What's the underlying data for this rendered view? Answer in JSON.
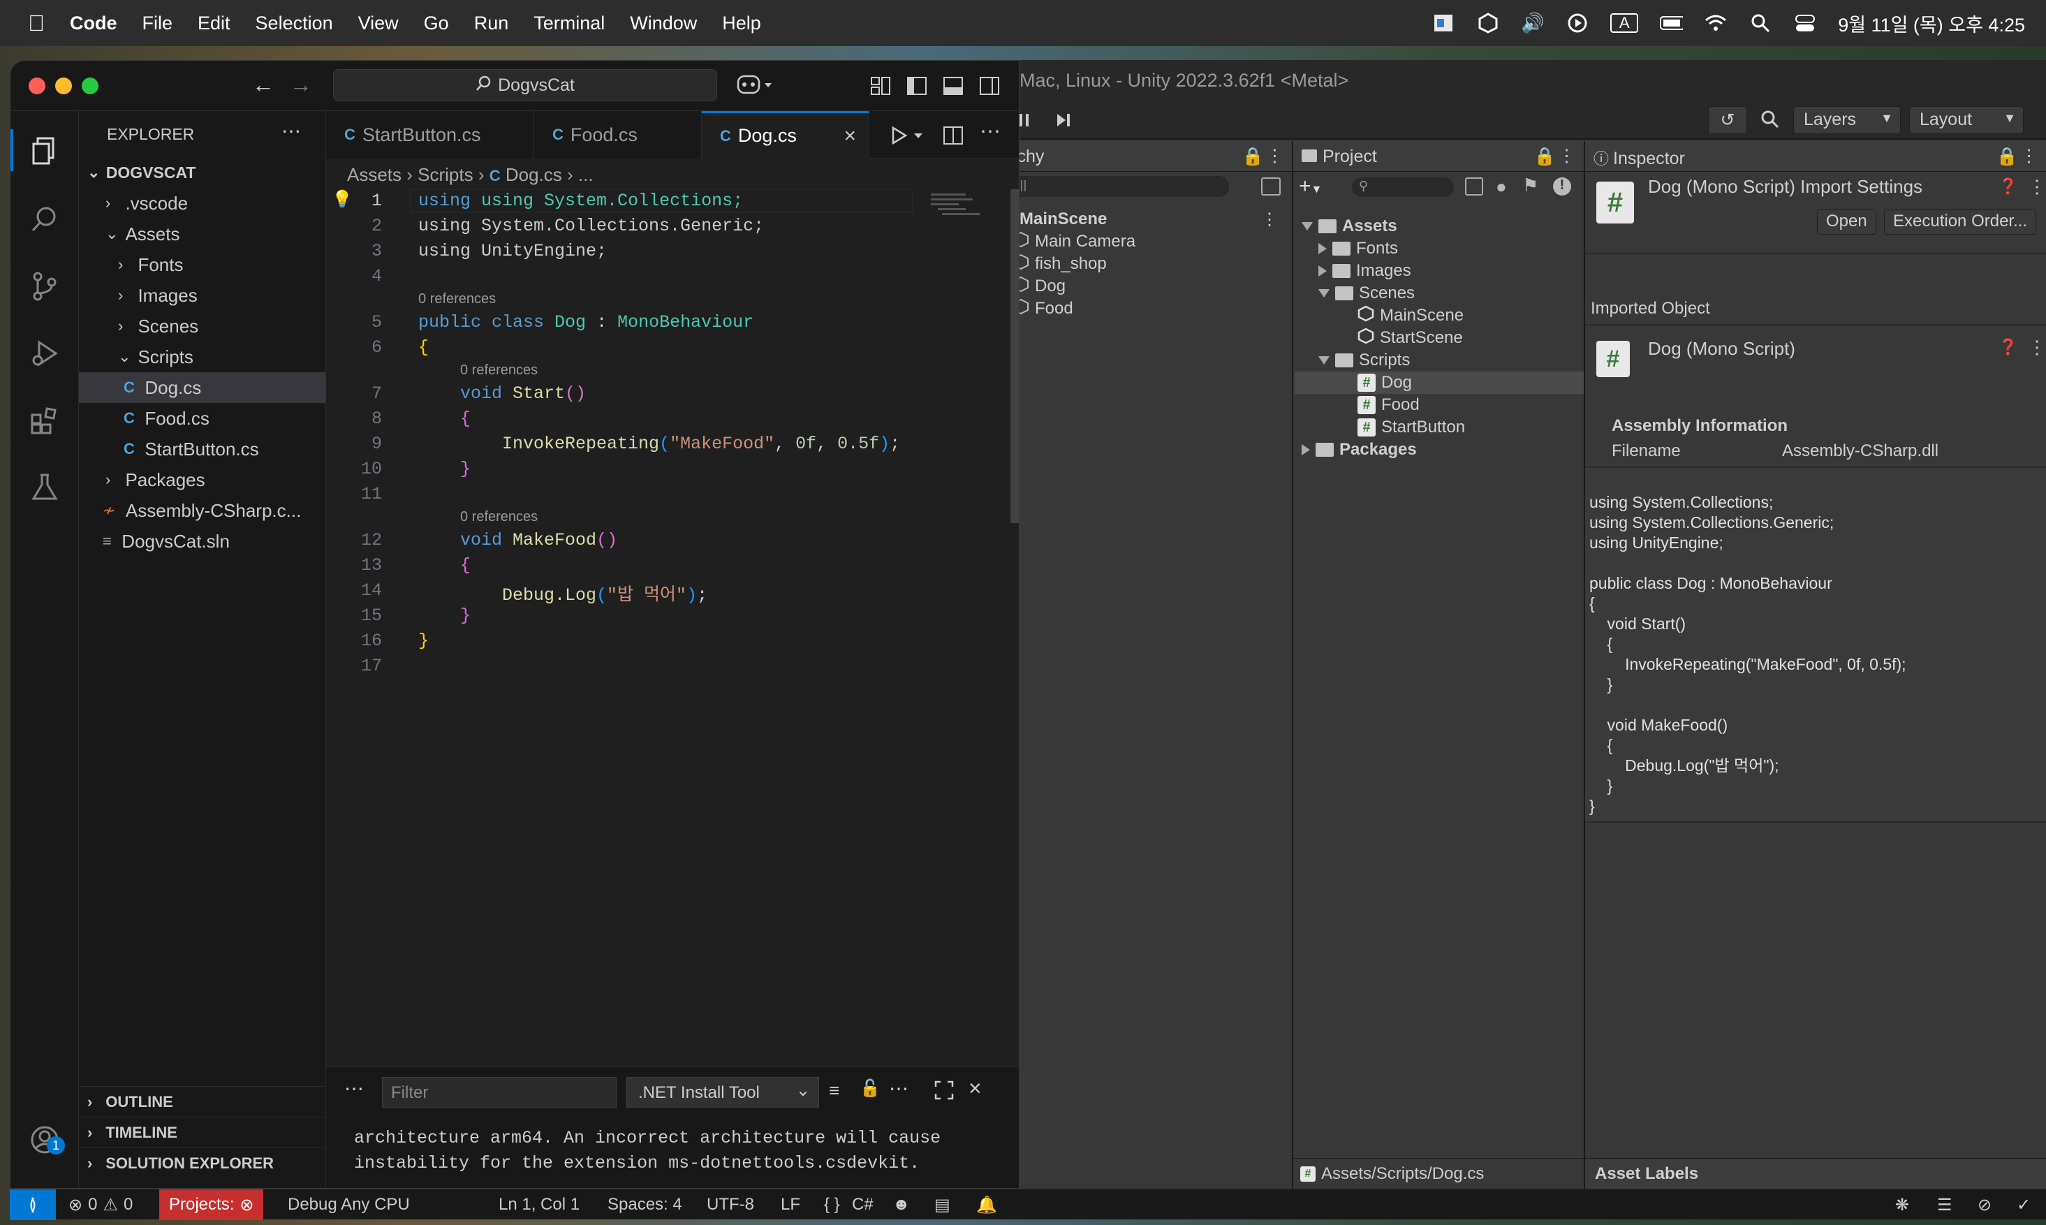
{
  "menubar": {
    "app": "Code",
    "items": [
      "File",
      "Edit",
      "Selection",
      "View",
      "Go",
      "Run",
      "Terminal",
      "Window",
      "Help"
    ],
    "clock": "9월 11일 (목) 오후 4:25",
    "input_indicator": "A"
  },
  "unity": {
    "title": "Mac, Linux - Unity 2022.3.62f1 <Metal>",
    "layers_label": "Layers",
    "layout_label": "Layout",
    "hierarchy": {
      "tab": "erarchy",
      "search_placeholder": "All",
      "scene": "MainScene",
      "items": [
        "Main Camera",
        "fish_shop",
        "Dog",
        "Food"
      ]
    },
    "project": {
      "tab": "Project",
      "tree": {
        "assets": "Assets",
        "fonts": "Fonts",
        "images": "Images",
        "scenes": "Scenes",
        "mainscene": "MainScene",
        "startscene": "StartScene",
        "scripts": "Scripts",
        "dog": "Dog",
        "food": "Food",
        "startbutton": "StartButton",
        "packages": "Packages"
      },
      "footer_path": "Assets/Scripts/Dog.cs"
    },
    "inspector": {
      "tab": "Inspector",
      "title": "Dog (Mono Script) Import Settings",
      "open_button": "Open",
      "exec_order_button": "Execution Order...",
      "imported_object": "Imported Object",
      "object_name": "Dog (Mono Script)",
      "assembly_info": "Assembly Information",
      "filename_label": "Filename",
      "filename_value": "Assembly-CSharp.dll",
      "source_lines": [
        "using System.Collections;",
        "using System.Collections.Generic;",
        "using UnityEngine;",
        "",
        "public class Dog : MonoBehaviour",
        "{",
        "    void Start()",
        "    {",
        "        InvokeRepeating(\"MakeFood\", 0f, 0.5f);",
        "    }",
        "",
        "    void MakeFood()",
        "    {",
        "        Debug.Log(\"밥 먹어\");",
        "    }",
        "}"
      ],
      "asset_labels": "Asset Labels"
    }
  },
  "vscode": {
    "search_title": "DogvsCat",
    "explorer_title": "EXPLORER",
    "root": "DOGVSCAT",
    "tree": {
      "vscode": ".vscode",
      "assets": "Assets",
      "fonts": "Fonts",
      "images": "Images",
      "scenes": "Scenes",
      "scripts": "Scripts",
      "dog": "Dog.cs",
      "food": "Food.cs",
      "startbutton": "StartButton.cs",
      "packages": "Packages",
      "csproj": "Assembly-CSharp.c...",
      "sln": "DogvsCat.sln"
    },
    "sections": {
      "outline": "OUTLINE",
      "timeline": "TIMELINE",
      "solution": "SOLUTION EXPLORER"
    },
    "tabs": {
      "startbutton": "StartButton.cs",
      "food": "Food.cs",
      "dog": "Dog.cs"
    },
    "breadcrumb": {
      "assets": "Assets",
      "scripts": "Scripts",
      "file": "Dog.cs",
      "more": "..."
    },
    "code": {
      "l1": "using System.Collections;",
      "l2": "using System.Collections.Generic;",
      "l3": "using UnityEngine;",
      "refs": "0 references",
      "l5_kw": "public class",
      "l5_name": "Dog",
      "l5_sep": " : ",
      "l5_base": "MonoBehaviour",
      "l7_kw": "void",
      "l7_fn": "Start",
      "l9_fn": "InvokeRepeating",
      "l9_str": "\"MakeFood\"",
      "l9_a1": "0f",
      "l9_a2": "0.5f",
      "l12_fn": "MakeFood",
      "l14_fn": "Debug.Log",
      "l14_str": "\"밥 먹어\""
    },
    "line_numbers": [
      "1",
      "2",
      "3",
      "4",
      "5",
      "6",
      "7",
      "8",
      "9",
      "10",
      "11",
      "12",
      "13",
      "14",
      "15",
      "16",
      "17"
    ],
    "panel": {
      "filter_placeholder": "Filter",
      "dropdown": ".NET Install Tool",
      "output_line1": "architecture arm64. An incorrect architecture will cause",
      "output_line2": "instability for the extension ms-dotnettools.csdevkit."
    },
    "notification_badge": "1"
  },
  "status": {
    "errors": "0",
    "warnings": "0",
    "projects": "Projects:",
    "config": "Debug Any CPU",
    "position": "Ln 1, Col 1",
    "spaces": "Spaces: 4",
    "encoding": "UTF-8",
    "eol": "LF",
    "language": "C#",
    "braces": "{ }"
  }
}
